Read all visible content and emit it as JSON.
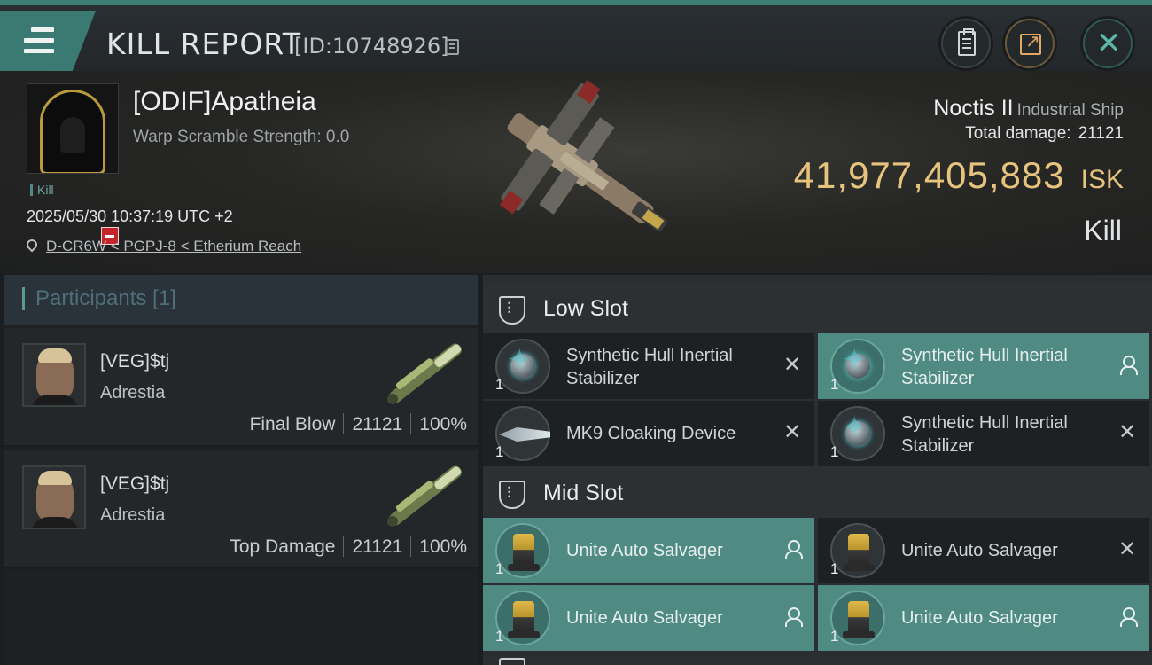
{
  "header": {
    "title": "KILL REPORT",
    "report_id": "[ID:10748926]"
  },
  "victim": {
    "name": "[ODIF]Apatheia",
    "warp_scramble": "Warp Scramble Strength: 0.0",
    "tag": "Kill",
    "timestamp": "2025/05/30 10:37:19 UTC +2",
    "location": "D-CR6W < PGPJ-8 < Etherium Reach"
  },
  "ship": {
    "name": "Noctis II",
    "class": "Industrial Ship",
    "damage_label": "Total damage:",
    "damage_value": "21121",
    "isk_value": "41,977,405,883",
    "isk_unit": "ISK",
    "result": "Kill"
  },
  "participants": {
    "header": "Participants [1]",
    "list": [
      {
        "name": "[VEG]$tj",
        "ship": "Adrestia",
        "role": "Final Blow",
        "damage": "21121",
        "percent": "100%"
      },
      {
        "name": "[VEG]$tj",
        "ship": "Adrestia",
        "role": "Top Damage",
        "damage": "21121",
        "percent": "100%"
      }
    ]
  },
  "slots": {
    "low": {
      "label": "Low Slot",
      "items": [
        {
          "name": "Synthetic Hull Inertial Stabilizer",
          "qty": "1",
          "status": "destroyed",
          "icon": "hull-stabilizer-icon"
        },
        {
          "name": "Synthetic Hull Inertial Stabilizer",
          "qty": "1",
          "status": "dropped",
          "icon": "hull-stabilizer-icon"
        },
        {
          "name": "MK9 Cloaking Device",
          "qty": "1",
          "status": "destroyed",
          "icon": "cloaking-device-icon"
        },
        {
          "name": "Synthetic Hull Inertial Stabilizer",
          "qty": "1",
          "status": "destroyed",
          "icon": "hull-stabilizer-icon"
        }
      ]
    },
    "mid": {
      "label": "Mid Slot",
      "items": [
        {
          "name": "Unite Auto Salvager",
          "qty": "1",
          "status": "dropped",
          "icon": "salvager-icon"
        },
        {
          "name": "Unite Auto Salvager",
          "qty": "1",
          "status": "destroyed",
          "icon": "salvager-icon"
        },
        {
          "name": "Unite Auto Salvager",
          "qty": "1",
          "status": "dropped",
          "icon": "salvager-icon"
        },
        {
          "name": "Unite Auto Salvager",
          "qty": "1",
          "status": "dropped",
          "icon": "salvager-icon"
        }
      ]
    }
  },
  "colors": {
    "accent": "#4f8b83",
    "isk": "#e7c37e",
    "destroyed_bg": "#1d2124",
    "dropped_bg": "#4f8b83"
  }
}
